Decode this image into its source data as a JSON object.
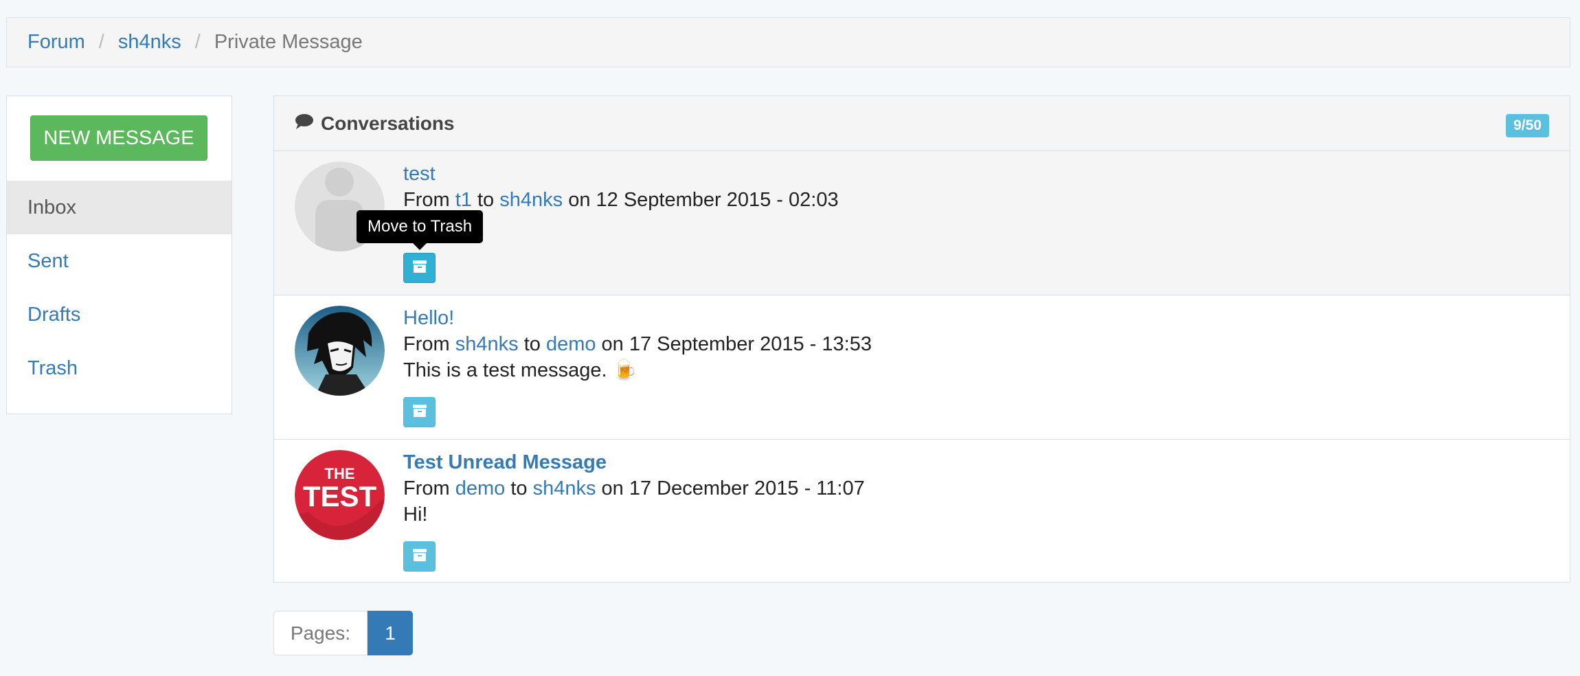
{
  "breadcrumb": {
    "items": [
      "Forum",
      "sh4nks"
    ],
    "current": "Private Message"
  },
  "sidebar": {
    "new_message_label": "NEW MESSAGE",
    "items": [
      {
        "label": "Inbox",
        "active": true
      },
      {
        "label": "Sent"
      },
      {
        "label": "Drafts"
      },
      {
        "label": "Trash"
      }
    ]
  },
  "panel": {
    "title": "Conversations",
    "count": "9/50"
  },
  "conversations": [
    {
      "subject": "test",
      "from_word": "From",
      "from": "t1",
      "to_word": "to",
      "to": "sh4nks",
      "date": "on 12 September 2015 - 02:03",
      "body": "",
      "avatar": "default-user-avatar"
    },
    {
      "subject": "Hello!",
      "from_word": "From",
      "from": "sh4nks",
      "to_word": "to",
      "to": "demo",
      "date": "on 17 September 2015 - 13:53",
      "body": "This is a test message. 🍺",
      "avatar": "anime-avatar"
    },
    {
      "subject": "Test Unread Message",
      "from_word": "From",
      "from": "demo",
      "to_word": "to",
      "to": "sh4nks",
      "date": "on 17 December 2015 - 11:07",
      "body": "Hi!",
      "avatar": "the-test-logo",
      "unread": true
    }
  ],
  "avatar_logo_text": {
    "line1": "THE",
    "line2": "TEST"
  },
  "tooltip": "Move to Trash",
  "pagination": {
    "label": "Pages:",
    "current": "1"
  },
  "colors": {
    "primary": "#337ab7",
    "success": "#5cb85c",
    "info": "#5bc0de",
    "background": "#f4f8fb"
  }
}
